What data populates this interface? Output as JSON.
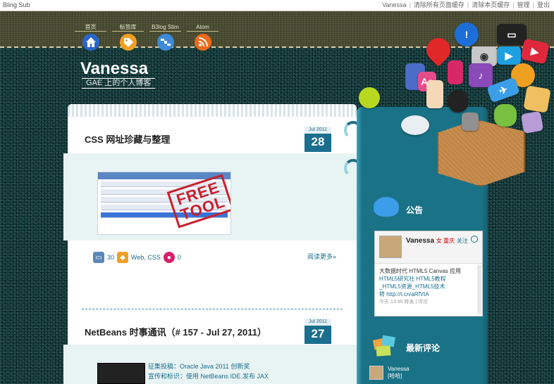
{
  "topbar": {
    "site": "Bling Sub",
    "links": [
      "Vanessa",
      "清除所有页面缓存",
      "清除本页缓存",
      "管理",
      "登出"
    ]
  },
  "nav": {
    "items": [
      {
        "label": "首页",
        "icon": "home-icon",
        "color": "#2a66c8"
      },
      {
        "label": "标签库",
        "icon": "tag-icon",
        "color": "#f0a020"
      },
      {
        "label": "B3log Stim",
        "icon": "satellite-icon",
        "color": "#3c8ad8"
      },
      {
        "label": "Atom",
        "icon": "rss-icon",
        "color": "#ee6a18"
      }
    ]
  },
  "blog": {
    "title": "Vanessa",
    "subtitle": "GAE 上的个人博客"
  },
  "posts": [
    {
      "title": "CSS 网址珍藏与整理",
      "month": "Jul 2011",
      "day": "28",
      "thumb_stamp": "FREE TOOL",
      "meta_views": "30",
      "meta_tags": "Web, CSS",
      "meta_comments": "0",
      "read_more": "阅读更多»"
    },
    {
      "title": "NetBeans 时事通讯（# 157 - Jul 27, 2011）",
      "month": "Jul 2011",
      "day": "27",
      "lines": [
        "征集投稿：Oracle Java 2011 创新奖",
        "宣传和标识：使用 NetBeans IDE 发布 JAX"
      ]
    }
  ],
  "sidebar": {
    "announcement_title": "公告",
    "weibo": {
      "name": "Vanessa",
      "tag": "女 重庆",
      "link": "关注",
      "body_lines": [
        "大数据时代 HTML5 Canvas 应用",
        "HTML5研究社 HTML5教程",
        "_HTML5资源_HTML5技术",
        "转 http://t.cn/aRfVtA"
      ],
      "footer": "今天 13:46  转发 | 评论"
    },
    "comments_title": "最新评论",
    "comment_author": "Vanessa",
    "comment_text": "[哈哈]"
  },
  "colors": {
    "accent": "#1a6e8e",
    "sidebar": "#1a7286",
    "badge": "#1a6e8e"
  }
}
